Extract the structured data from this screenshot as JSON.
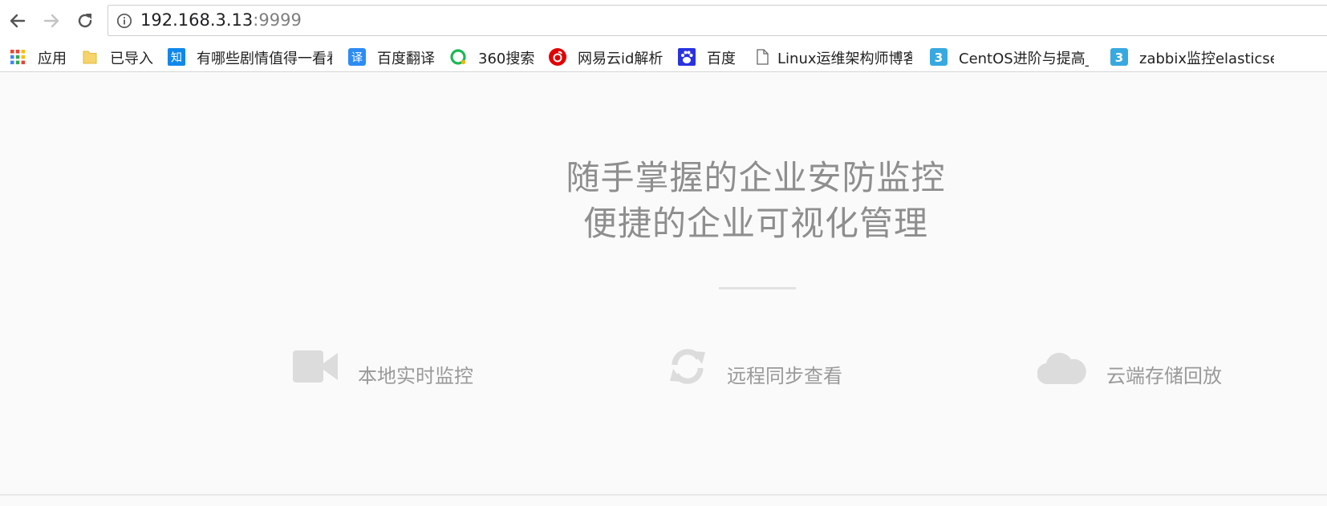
{
  "browser": {
    "url_host": "192.168.3.13",
    "url_port": ":9999"
  },
  "bookmarks": [
    {
      "label": "应用",
      "icon": "apps-grid-icon"
    },
    {
      "label": "已导入",
      "icon": "folder-icon"
    },
    {
      "label": "有哪些剧情值得一看看",
      "icon": "zhihu-icon"
    },
    {
      "label": "百度翻译",
      "icon": "baidu-translate-icon"
    },
    {
      "label": "360搜索",
      "icon": "so360-icon"
    },
    {
      "label": "网易云id解析",
      "icon": "netease-music-icon"
    },
    {
      "label": "百度",
      "icon": "baidu-paw-icon"
    },
    {
      "label": "Linux运维架构师博客",
      "icon": "page-icon"
    },
    {
      "label": "CentOS进阶与提高_",
      "icon": "blog-3-icon"
    },
    {
      "label": "zabbix监控elasticsearch",
      "icon": "blog-3-icon"
    }
  ],
  "hero": {
    "headline_line1": "随手掌握的企业安防监控",
    "headline_line2": "便捷的企业可视化管理"
  },
  "features": [
    {
      "label": "本地实时监控",
      "icon": "video-camera-icon"
    },
    {
      "label": "远程同步查看",
      "icon": "sync-icon"
    },
    {
      "label": "云端存储回放",
      "icon": "cloud-icon"
    }
  ],
  "colors": {
    "headline": "#8e8e8e",
    "feature_icon": "#dcdcdc",
    "background": "#fafafa"
  }
}
